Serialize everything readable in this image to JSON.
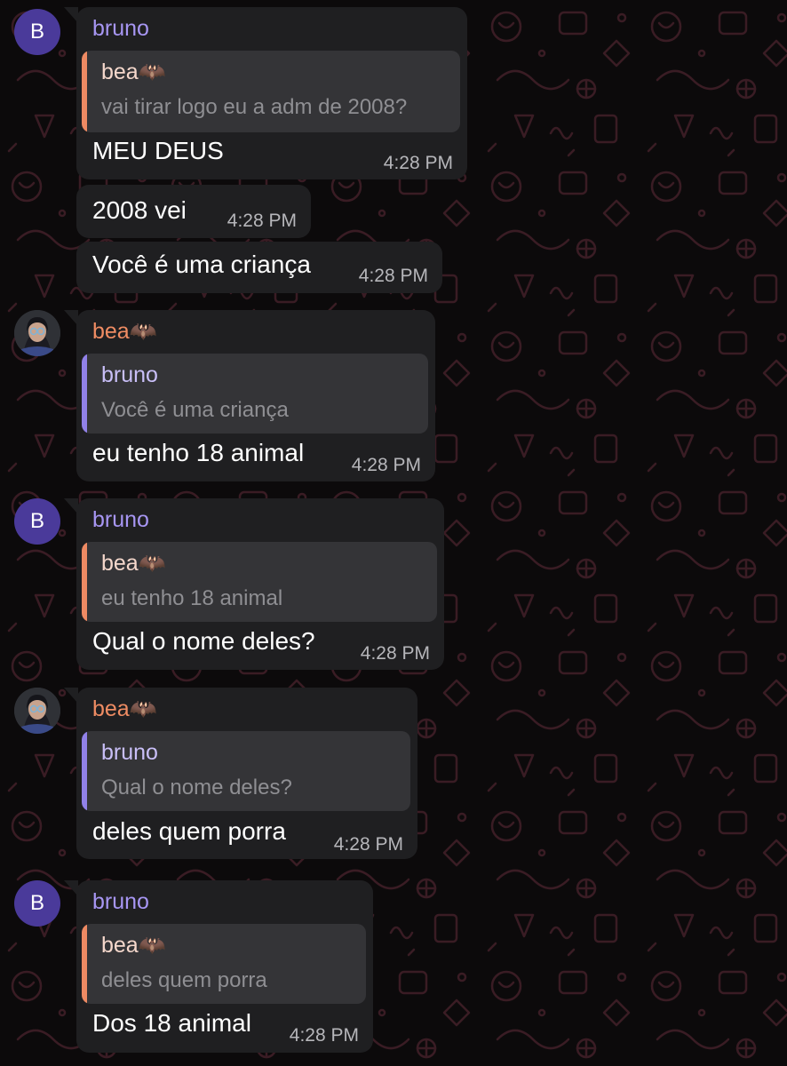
{
  "colors": {
    "background": "#0c0a0b",
    "bubble": "#1f1f21",
    "quote_background": "#343437",
    "bruno_name": "#a796f3",
    "bea_name": "#ef8c63",
    "bruno_avatar": "#4a3a9a",
    "timestamp": "#b6b6ba"
  },
  "contacts": {
    "bruno": {
      "name": "bruno",
      "avatar_letter": "B"
    },
    "bea": {
      "name": "bea",
      "name_emoji": "🦇",
      "avatar": "profile-photo-icon"
    }
  },
  "messages": [
    {
      "sender": "bruno",
      "reply_to": {
        "name": "bea",
        "text": "vai tirar logo eu a adm de 2008?"
      },
      "text": "MEU DEUS",
      "time": "4:28 PM"
    },
    {
      "sender": "bruno",
      "text": "2008 vei",
      "time": "4:28 PM"
    },
    {
      "sender": "bruno",
      "text": "Você é uma criança",
      "time": "4:28 PM"
    },
    {
      "sender": "bea",
      "reply_to": {
        "name": "bruno",
        "text": "Você é uma criança"
      },
      "text": "eu tenho 18 animal",
      "time": "4:28 PM"
    },
    {
      "sender": "bruno",
      "reply_to": {
        "name": "bea",
        "text": "eu tenho 18 animal"
      },
      "text": "Qual o nome deles?",
      "time": "4:28 PM"
    },
    {
      "sender": "bea",
      "reply_to": {
        "name": "bruno",
        "text": "Qual o nome deles?"
      },
      "text": "deles quem porra",
      "time": "4:28 PM"
    },
    {
      "sender": "bruno",
      "reply_to": {
        "name": "bea",
        "text": "deles quem porra"
      },
      "text": "Dos 18 animal",
      "time": "4:28 PM"
    }
  ]
}
